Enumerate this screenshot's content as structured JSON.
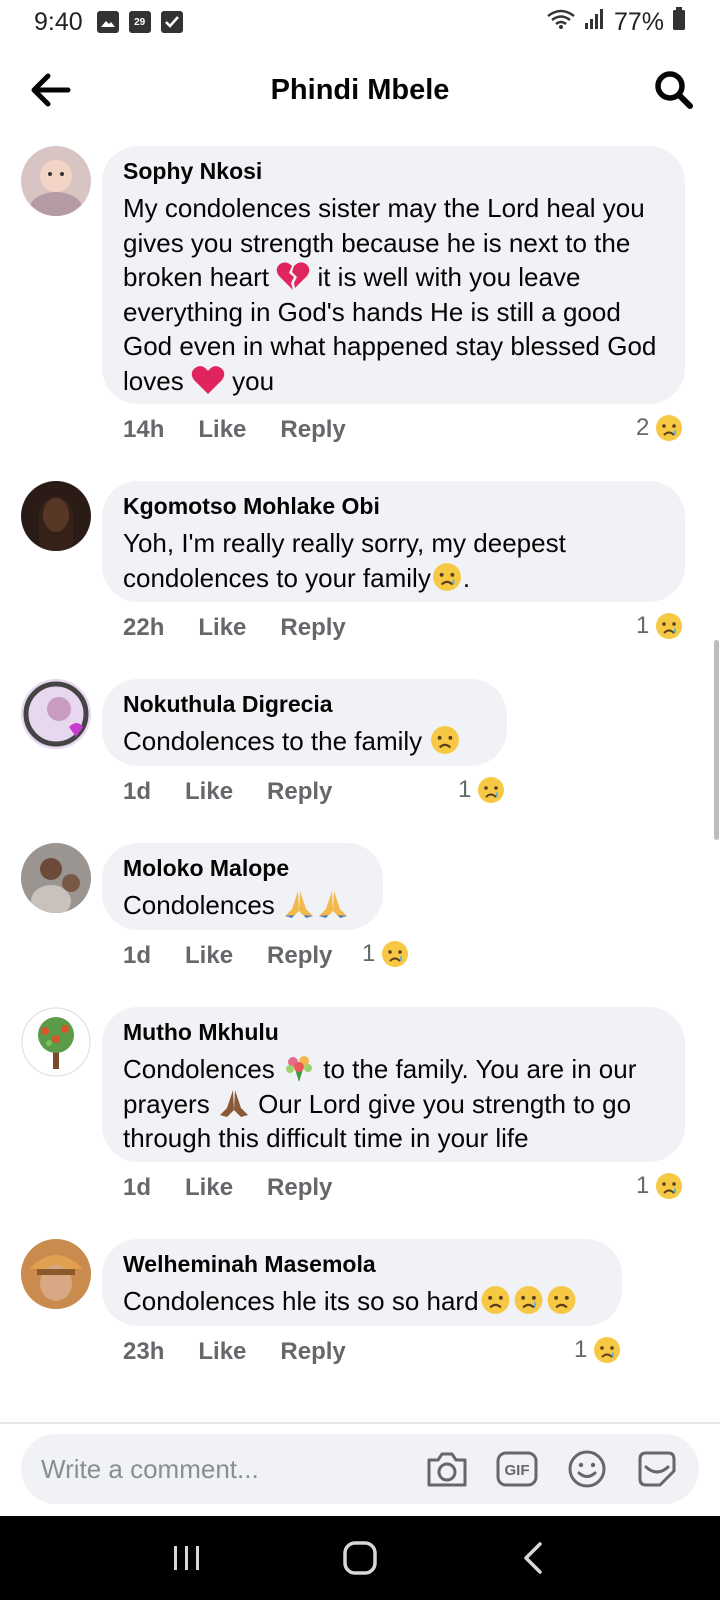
{
  "status": {
    "time": "9:40",
    "calendar_day": "29",
    "battery": "77%"
  },
  "header": {
    "title": "Phindi Mbele"
  },
  "comments": [
    {
      "author": "Sophy Nkosi",
      "text_parts": [
        "My condolences sister may the Lord heal you gives you strength because he is next to the broken heart ",
        " it is well with you leave everything in God's hands He is still a good God even in what happened stay blessed God loves ",
        " you"
      ],
      "time": "14h",
      "like": "Like",
      "reply": "Reply",
      "reaction_count": "2",
      "reaction_icon": "crying-face-icon"
    },
    {
      "author": "Kgomotso Mohlake Obi",
      "text_parts": [
        "Yoh, I'm really really sorry, my deepest condolences to your family",
        "."
      ],
      "time": "22h",
      "like": "Like",
      "reply": "Reply",
      "reaction_count": "1",
      "reaction_icon": "crying-face-icon"
    },
    {
      "author": "Nokuthula Digrecia",
      "text_parts": [
        "Condolences to the family "
      ],
      "time": "1d",
      "like": "Like",
      "reply": "Reply",
      "reaction_count": "1",
      "reaction_icon": "crying-face-icon"
    },
    {
      "author": "Moloko Malope",
      "text_parts": [
        "Condolences "
      ],
      "time": "1d",
      "like": "Like",
      "reply": "Reply",
      "reaction_count": "1",
      "reaction_icon": "crying-face-icon"
    },
    {
      "author": "Mutho Mkhulu",
      "text_parts": [
        "Condolences ",
        " to the family. You are in our prayers ",
        " Our Lord give you strength to go through this difficult time in your life"
      ],
      "time": "1d",
      "like": "Like",
      "reply": "Reply",
      "reaction_count": "1",
      "reaction_icon": "crying-face-icon"
    },
    {
      "author": "Welheminah Masemola",
      "text_parts": [
        "Condolences hle its so so hard"
      ],
      "time": "23h",
      "like": "Like",
      "reply": "Reply",
      "reaction_count": "1",
      "reaction_icon": "crying-face-icon"
    }
  ],
  "composer": {
    "placeholder": "Write a comment..."
  },
  "colors": {
    "bubble": "#f0f2f5",
    "meta_text": "#65676b",
    "heart_red": "#e0245e",
    "cry_yellow": "#f7c844"
  }
}
